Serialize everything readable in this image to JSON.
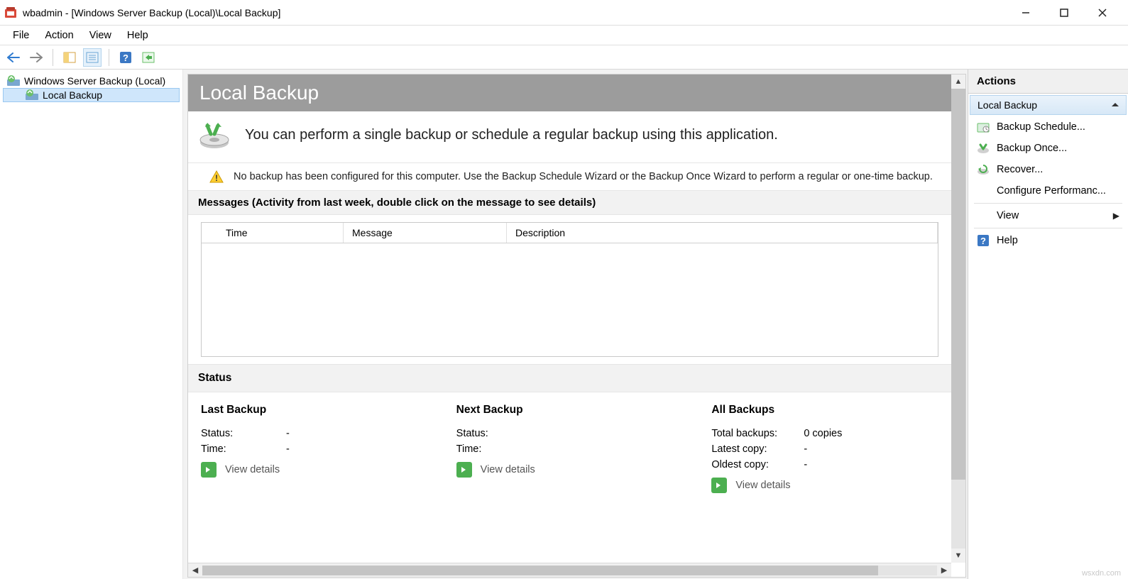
{
  "titlebar": {
    "title": "wbadmin - [Windows Server Backup (Local)\\Local Backup]"
  },
  "menu": {
    "file": "File",
    "action": "Action",
    "view": "View",
    "help": "Help"
  },
  "tree": {
    "root": "Windows Server Backup (Local)",
    "child": "Local Backup"
  },
  "header": {
    "title": "Local Backup"
  },
  "intro": {
    "text": "You can perform a single backup or schedule a regular backup using this application."
  },
  "warning": {
    "text": "No backup has been configured for this computer. Use the Backup Schedule Wizard or the Backup Once Wizard to perform a regular or one-time backup."
  },
  "messages": {
    "heading": "Messages (Activity from last week, double click on the message to see details)",
    "columns": {
      "time": "Time",
      "message": "Message",
      "description": "Description"
    }
  },
  "status": {
    "heading": "Status",
    "last": {
      "title": "Last Backup",
      "status_label": "Status:",
      "status_value": "-",
      "time_label": "Time:",
      "time_value": "-",
      "view": "View details"
    },
    "next": {
      "title": "Next Backup",
      "status_label": "Status:",
      "status_value": "",
      "time_label": "Time:",
      "time_value": "",
      "view": "View details"
    },
    "all": {
      "title": "All Backups",
      "total_label": "Total backups:",
      "total_value": "0 copies",
      "latest_label": "Latest copy:",
      "latest_value": "-",
      "oldest_label": "Oldest copy:",
      "oldest_value": "-",
      "view": "View details"
    }
  },
  "actions": {
    "header": "Actions",
    "group": "Local Backup",
    "items": {
      "schedule": "Backup Schedule...",
      "once": "Backup Once...",
      "recover": "Recover...",
      "perf": "Configure Performanc...",
      "view": "View",
      "help": "Help"
    }
  },
  "watermark": "wsxdn.com"
}
